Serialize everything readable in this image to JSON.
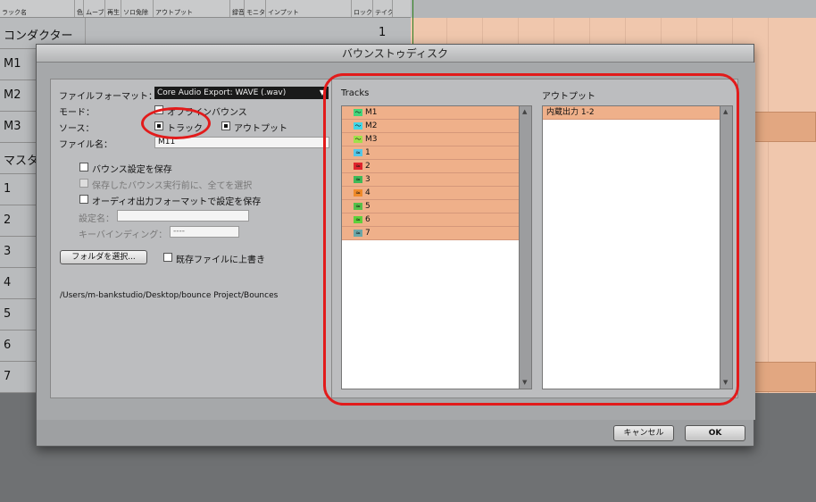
{
  "background": {
    "header_columns": [
      "ラック名",
      "色",
      "ムーブ",
      "再生",
      "ソロ免除",
      "アウトプット",
      "録音",
      "モニタ",
      "インプット",
      "ロック",
      "テイク"
    ],
    "tracks": [
      "コンダクター",
      "M1",
      "M2",
      "M3",
      "マスタ",
      "1",
      "2",
      "3",
      "4",
      "5",
      "6",
      "7"
    ],
    "conductor_take": "1"
  },
  "dialog": {
    "title": "バウンストゥディスク",
    "file_format_label": "ファイルフォーマット：",
    "file_format_value": "Core Audio Export: WAVE (.wav)",
    "mode_label": "モード：",
    "mode_offline": "オフラインバウンス",
    "source_label": "ソース：",
    "source_track": "トラック",
    "source_output": "アウトプット",
    "filename_label": "ファイル名：",
    "filename_value": "M11",
    "save_bounce_settings": "バウンス設定を保存",
    "select_all_before": "保存したバウンス実行前に、全てを選択",
    "save_audio_format": "オーディオ出力フォーマットで設定を保存",
    "settings_name_label": "設定名：",
    "key_binding_label": "キーバインディング：",
    "key_binding_value": "----",
    "choose_folder": "フォルダを選択...",
    "overwrite_existing": "既存ファイルに上書き",
    "path": "/Users/m-bankstudio/Desktop/bounce Project/Bounces",
    "tracks_header": "Tracks",
    "output_header": "アウトプット",
    "tracks": [
      {
        "name": "M1",
        "icon": "midi-wave-icon",
        "color": "#43d47a"
      },
      {
        "name": "M2",
        "icon": "midi-wave-icon",
        "color": "#42d6e6"
      },
      {
        "name": "M3",
        "icon": "midi-wave-icon",
        "color": "#9fe04a"
      },
      {
        "name": "1",
        "icon": "audio-wave-icon",
        "color": "#54c7e8"
      },
      {
        "name": "2",
        "icon": "audio-wave-icon",
        "color": "#e0242d"
      },
      {
        "name": "3",
        "icon": "audio-wave-icon",
        "color": "#3fba58"
      },
      {
        "name": "4",
        "icon": "audio-wave-icon",
        "color": "#f08a2a"
      },
      {
        "name": "5",
        "icon": "audio-wave-icon",
        "color": "#56c04a"
      },
      {
        "name": "6",
        "icon": "audio-wave-icon",
        "color": "#5ed13c"
      },
      {
        "name": "7",
        "icon": "audio-wave-icon",
        "color": "#6aa7a8"
      }
    ],
    "outputs": [
      "内蔵出力 1-2"
    ],
    "cancel": "キャンセル",
    "ok": "OK"
  },
  "colors": {
    "highlight_row": "#efb08a",
    "annotation_ring": "#e21b1b"
  }
}
